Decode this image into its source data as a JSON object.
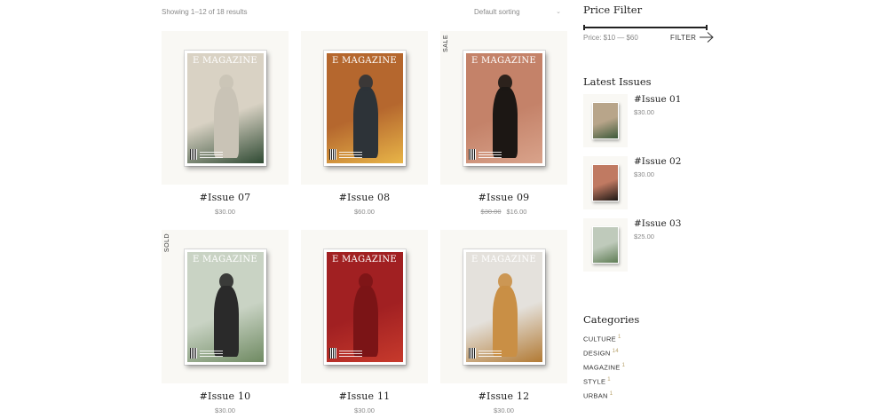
{
  "toolbar": {
    "results_text": "Showing 1–12 of 18 results",
    "sorting_selected": "Default sorting"
  },
  "products": [
    {
      "name": "#Issue 07",
      "price": "$30.00",
      "badge": "",
      "cover_title": "E MAGAZINE",
      "colors": {
        "bg": "#d9d2c4",
        "accent": "#2f4a33",
        "figure": "#c9c3b6"
      }
    },
    {
      "name": "#Issue 08",
      "price": "$60.00",
      "badge": "",
      "cover_title": "E MAGAZINE",
      "colors": {
        "bg": "#b5672e",
        "accent": "#e8b548",
        "figure": "#2d3338"
      }
    },
    {
      "name": "#Issue 09",
      "price_old": "$30.00",
      "price": "$16.00",
      "badge": "SALE",
      "cover_title": "E MAGAZINE",
      "colors": {
        "bg": "#c48269",
        "accent": "#d9a38b",
        "figure": "#1c1714"
      }
    },
    {
      "name": "#Issue 10",
      "price": "$30.00",
      "badge": "SOLD",
      "cover_title": "E MAGAZINE",
      "colors": {
        "bg": "#c9d3c4",
        "accent": "#6f8a62",
        "figure": "#2a2a2a"
      }
    },
    {
      "name": "#Issue 11",
      "price": "$30.00",
      "badge": "",
      "cover_title": "E MAGAZINE",
      "colors": {
        "bg": "#a12022",
        "accent": "#c73a2c",
        "figure": "#7b1416"
      }
    },
    {
      "name": "#Issue 12",
      "price": "$30.00",
      "badge": "",
      "cover_title": "E MAGAZINE",
      "colors": {
        "bg": "#e4e1dc",
        "accent": "#b27a34",
        "figure": "#c98f45"
      }
    }
  ],
  "sidebar": {
    "price_filter": {
      "title": "Price Filter",
      "label": "Price: $10 — $60",
      "filter_label": "FILTER"
    },
    "latest": {
      "title": "Latest Issues",
      "items": [
        {
          "name": "#Issue 01",
          "price": "$30.00",
          "colors": {
            "bg": "#b8a58a",
            "accent": "#3c5a3a"
          }
        },
        {
          "name": "#Issue 02",
          "price": "$30.00",
          "colors": {
            "bg": "#c07a62",
            "accent": "#1c1714"
          }
        },
        {
          "name": "#Issue 03",
          "price": "$25.00",
          "colors": {
            "bg": "#bfcabb",
            "accent": "#5f7d55"
          }
        }
      ]
    },
    "categories": {
      "title": "Categories",
      "items": [
        {
          "label": "CULTURE",
          "count": "1"
        },
        {
          "label": "DESIGN",
          "count": "14"
        },
        {
          "label": "MAGAZINE",
          "count": "1"
        },
        {
          "label": "STYLE",
          "count": "1"
        },
        {
          "label": "URBAN",
          "count": "1"
        }
      ]
    }
  }
}
